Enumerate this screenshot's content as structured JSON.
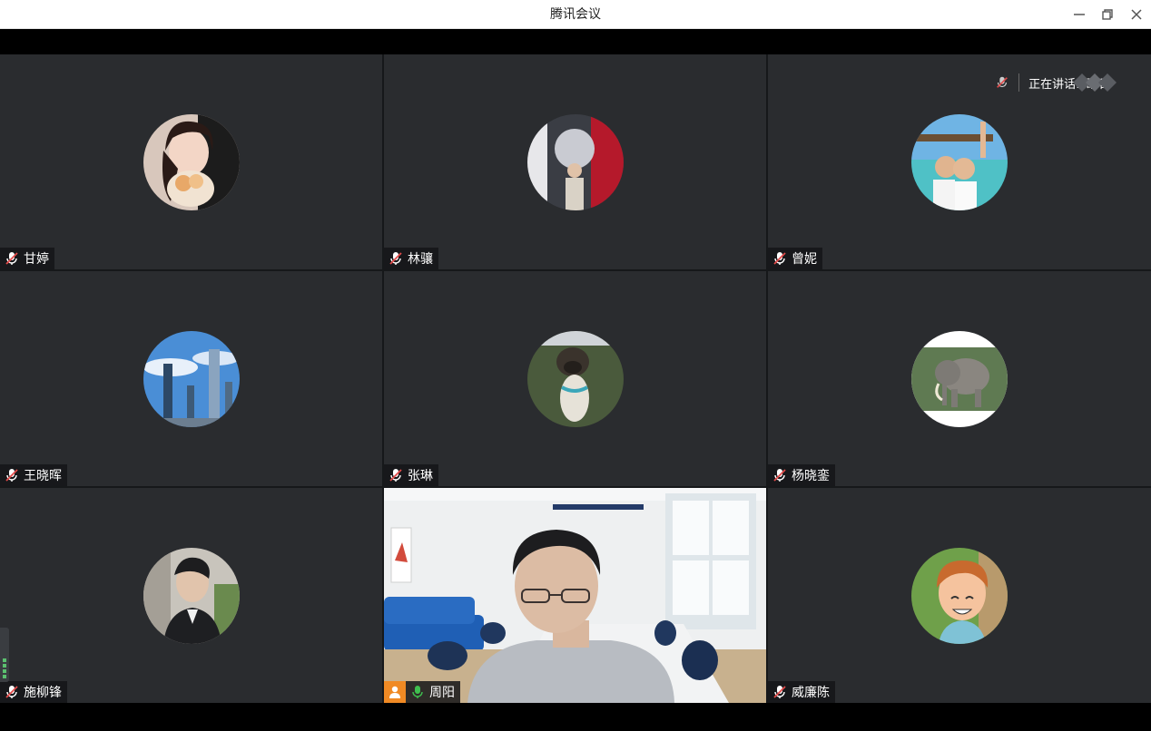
{
  "window": {
    "title": "腾讯会议",
    "controls": [
      "minimize-icon",
      "restore-icon",
      "close-icon"
    ]
  },
  "status": {
    "speaking_label": "正在讲话: 周阳;"
  },
  "participants": [
    {
      "name": "甘婷",
      "mic": "muted",
      "avatar": "girl-with-cat"
    },
    {
      "name": "林骧",
      "mic": "muted",
      "avatar": "man-in-gallery"
    },
    {
      "name": "曾妮",
      "mic": "muted",
      "avatar": "couple-at-beach"
    },
    {
      "name": "王晓晖",
      "mic": "muted",
      "avatar": "city-skyscrapers"
    },
    {
      "name": "张琳",
      "mic": "muted",
      "avatar": "pug-dog"
    },
    {
      "name": "杨晓銮",
      "mic": "muted",
      "avatar": "elephant"
    },
    {
      "name": "施柳锋",
      "mic": "muted",
      "avatar": "man-portrait"
    },
    {
      "name": "周阳",
      "mic": "active",
      "avatar": "live-video-office",
      "host": true
    },
    {
      "name": "威廉陈",
      "mic": "muted",
      "avatar": "cartoon-boy"
    }
  ],
  "colors": {
    "tile_bg": "#2a2c2f",
    "active_border": "#3fa66a",
    "host_badge": "#f08a24",
    "mic_active": "#3fbf4f",
    "mic_muted": "#e24a4a"
  }
}
